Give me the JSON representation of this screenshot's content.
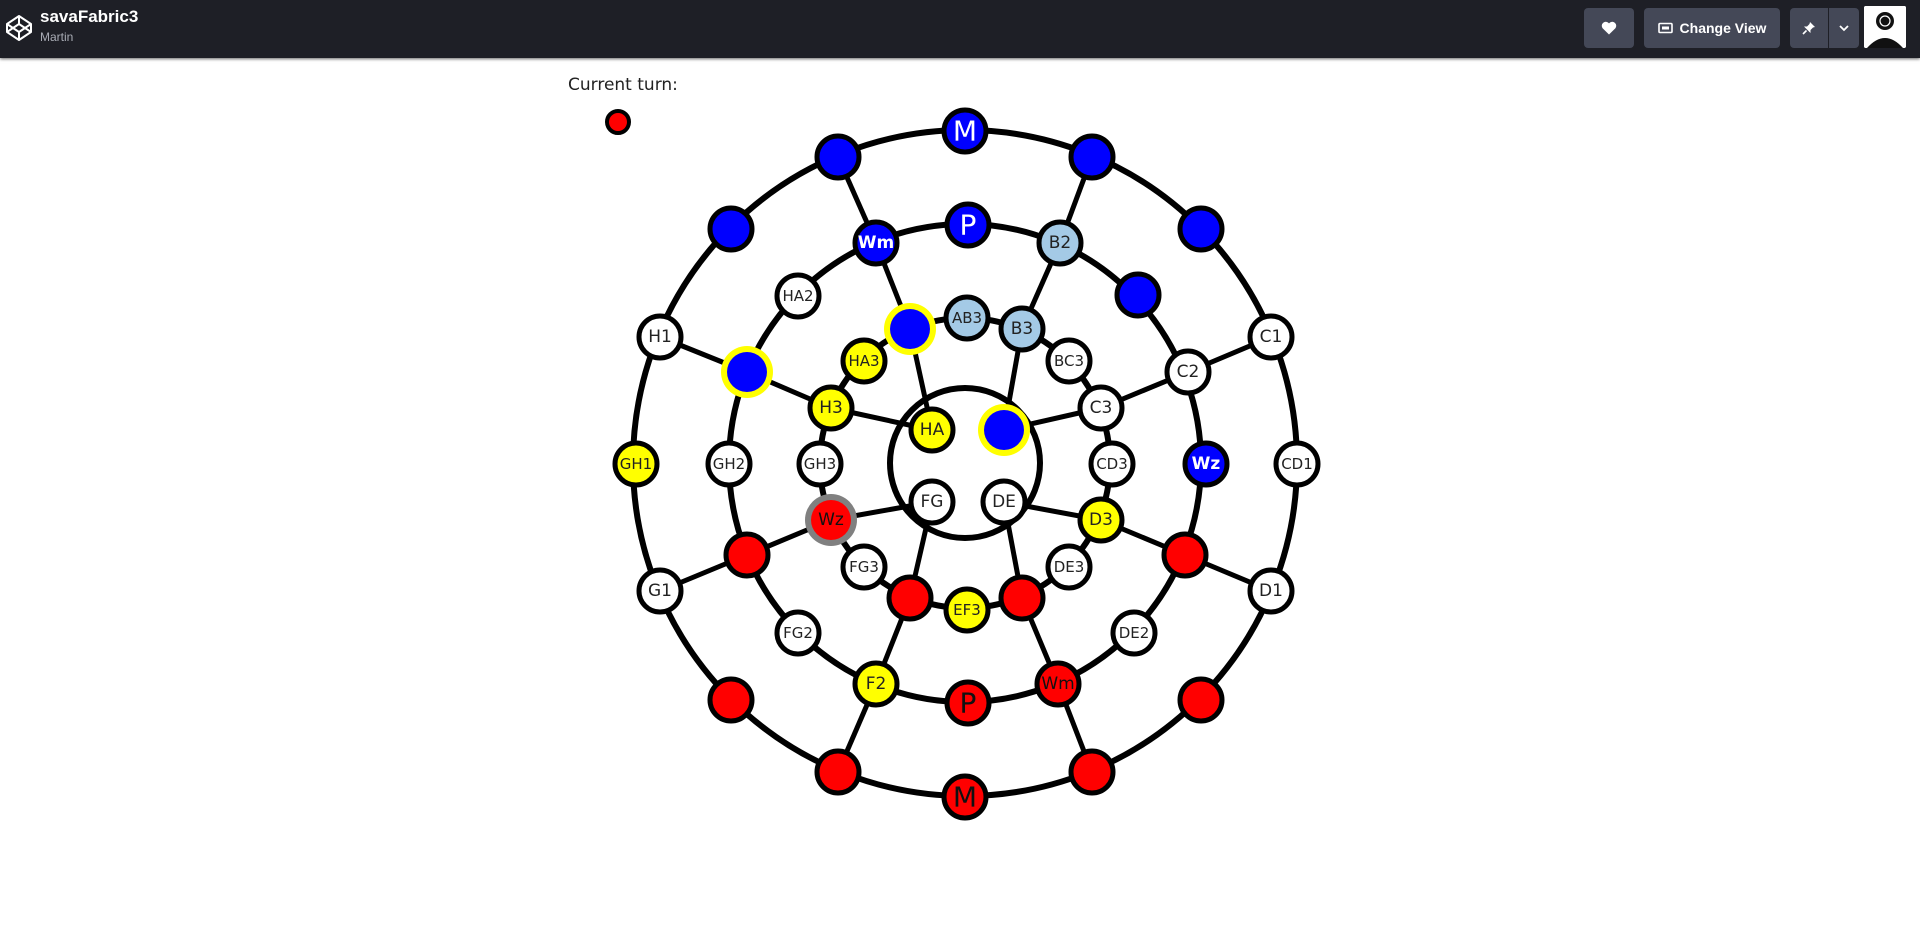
{
  "header": {
    "title": "savaFabric3",
    "author": "Martin",
    "change_view_label": "Change View"
  },
  "game": {
    "current_turn_label": "Current turn:",
    "current_turn_color": "#ff0000"
  },
  "colors": {
    "blue": "#0000ff",
    "red": "#ff0000",
    "yellow": "#ffff00",
    "lightblue": "#a4cae6",
    "white": "#ffffff",
    "highlight": "#ffff00",
    "selected": "#808080"
  },
  "nodes": [
    {
      "id": "M-top",
      "label": "M",
      "fill": "blue",
      "text": "#ffffff",
      "big": true
    },
    {
      "id": "o-top-l",
      "label": "",
      "fill": "blue"
    },
    {
      "id": "o-top-r",
      "label": "",
      "fill": "blue"
    },
    {
      "id": "o-ul",
      "label": "",
      "fill": "blue"
    },
    {
      "id": "o-ur",
      "label": "",
      "fill": "blue"
    },
    {
      "id": "H1",
      "label": "H1",
      "fill": "white"
    },
    {
      "id": "C1",
      "label": "C1",
      "fill": "white"
    },
    {
      "id": "GH1",
      "label": "GH1",
      "fill": "yellow"
    },
    {
      "id": "CD1",
      "label": "CD1",
      "fill": "white"
    },
    {
      "id": "G1",
      "label": "G1",
      "fill": "white"
    },
    {
      "id": "D1",
      "label": "D1",
      "fill": "white"
    },
    {
      "id": "o-ll",
      "label": "",
      "fill": "red"
    },
    {
      "id": "o-lr",
      "label": "",
      "fill": "red"
    },
    {
      "id": "o-bot-l",
      "label": "",
      "fill": "red"
    },
    {
      "id": "o-bot-r",
      "label": "",
      "fill": "red"
    },
    {
      "id": "M-bot",
      "label": "M",
      "fill": "red",
      "text": "#111111",
      "big": true
    },
    {
      "id": "P-top",
      "label": "P",
      "fill": "blue",
      "text": "#ffffff",
      "big": true
    },
    {
      "id": "Wm-top",
      "label": "Wm",
      "fill": "blue",
      "text": "#ffffff",
      "bold": true
    },
    {
      "id": "B2",
      "label": "B2",
      "fill": "lightblue"
    },
    {
      "id": "HA2",
      "label": "HA2",
      "fill": "white"
    },
    {
      "id": "m-ur",
      "label": "",
      "fill": "blue"
    },
    {
      "id": "m-ul",
      "label": "",
      "fill": "blue",
      "ring": "highlight"
    },
    {
      "id": "C2",
      "label": "C2",
      "fill": "white"
    },
    {
      "id": "GH2",
      "label": "GH2",
      "fill": "white"
    },
    {
      "id": "Wz-blue",
      "label": "Wz",
      "fill": "blue",
      "text": "#ffffff",
      "bold": true
    },
    {
      "id": "m-ll",
      "label": "",
      "fill": "red"
    },
    {
      "id": "m-lr",
      "label": "",
      "fill": "red"
    },
    {
      "id": "FG2",
      "label": "FG2",
      "fill": "white"
    },
    {
      "id": "DE2",
      "label": "DE2",
      "fill": "white"
    },
    {
      "id": "F2",
      "label": "F2",
      "fill": "yellow"
    },
    {
      "id": "Wm-bot",
      "label": "Wm",
      "fill": "red",
      "text": "#111111"
    },
    {
      "id": "P-bot",
      "label": "P",
      "fill": "red",
      "text": "#111111",
      "big": true
    },
    {
      "id": "AB3",
      "label": "AB3",
      "fill": "lightblue"
    },
    {
      "id": "i-ul",
      "label": "",
      "fill": "blue",
      "ring": "highlight"
    },
    {
      "id": "B3",
      "label": "B3",
      "fill": "lightblue"
    },
    {
      "id": "HA3",
      "label": "HA3",
      "fill": "yellow"
    },
    {
      "id": "BC3",
      "label": "BC3",
      "fill": "white"
    },
    {
      "id": "H3",
      "label": "H3",
      "fill": "yellow"
    },
    {
      "id": "C3",
      "label": "C3",
      "fill": "white"
    },
    {
      "id": "GH3",
      "label": "GH3",
      "fill": "white"
    },
    {
      "id": "CD3",
      "label": "CD3",
      "fill": "white"
    },
    {
      "id": "Wz-red",
      "label": "Wz",
      "fill": "red",
      "text": "#111111",
      "ring": "selected"
    },
    {
      "id": "D3",
      "label": "D3",
      "fill": "yellow"
    },
    {
      "id": "FG3",
      "label": "FG3",
      "fill": "white"
    },
    {
      "id": "DE3",
      "label": "DE3",
      "fill": "white"
    },
    {
      "id": "i-ll",
      "label": "",
      "fill": "red"
    },
    {
      "id": "i-lr",
      "label": "",
      "fill": "red"
    },
    {
      "id": "EF3",
      "label": "EF3",
      "fill": "yellow"
    },
    {
      "id": "HA",
      "label": "HA",
      "fill": "yellow"
    },
    {
      "id": "c-blue",
      "label": "",
      "fill": "blue",
      "ring": "highlight"
    },
    {
      "id": "FG",
      "label": "FG",
      "fill": "white"
    },
    {
      "id": "DE",
      "label": "DE",
      "fill": "white"
    }
  ]
}
